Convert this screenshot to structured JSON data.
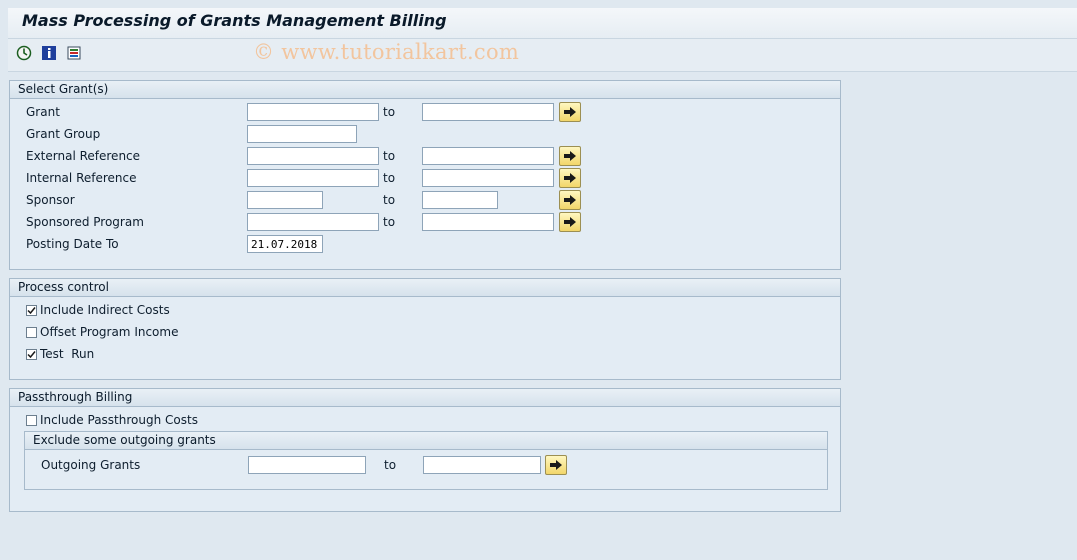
{
  "window": {
    "title": "Mass Processing of Grants Management Billing",
    "watermark": "© www.tutorialkart.com"
  },
  "toolbar": {
    "icons": [
      "execute-icon",
      "program-info-icon",
      "selection-options-icon"
    ]
  },
  "select_grants": {
    "heading": "Select Grant(s)",
    "to_label": "to",
    "rows": [
      {
        "label": "Grant",
        "from": "",
        "to": ""
      },
      {
        "label": "Grant Group",
        "from": ""
      },
      {
        "label": "External Reference",
        "from": "",
        "to": ""
      },
      {
        "label": "Internal Reference",
        "from": "",
        "to": ""
      },
      {
        "label": "Sponsor",
        "from": "",
        "to": ""
      },
      {
        "label": "Sponsored Program",
        "from": "",
        "to": ""
      },
      {
        "label": "Posting Date To",
        "from": "21.07.2018"
      }
    ]
  },
  "process_control": {
    "heading": "Process control",
    "options": [
      {
        "label": "Include Indirect Costs",
        "checked": true
      },
      {
        "label": "Offset Program Income",
        "checked": false
      },
      {
        "label": "Test  Run",
        "checked": true
      }
    ]
  },
  "passthrough": {
    "heading": "Passthrough Billing",
    "include": {
      "label": "Include Passthrough Costs",
      "checked": false
    },
    "exclude": {
      "heading": "Exclude some outgoing grants",
      "outgoing_label": "Outgoing Grants",
      "to_label": "to",
      "from": "",
      "to": ""
    }
  },
  "colors": {
    "background": "#dfe8f0",
    "group_border": "#a7bacb",
    "button_yellow": "#f2d66a",
    "watermark": "#f2c59e"
  }
}
